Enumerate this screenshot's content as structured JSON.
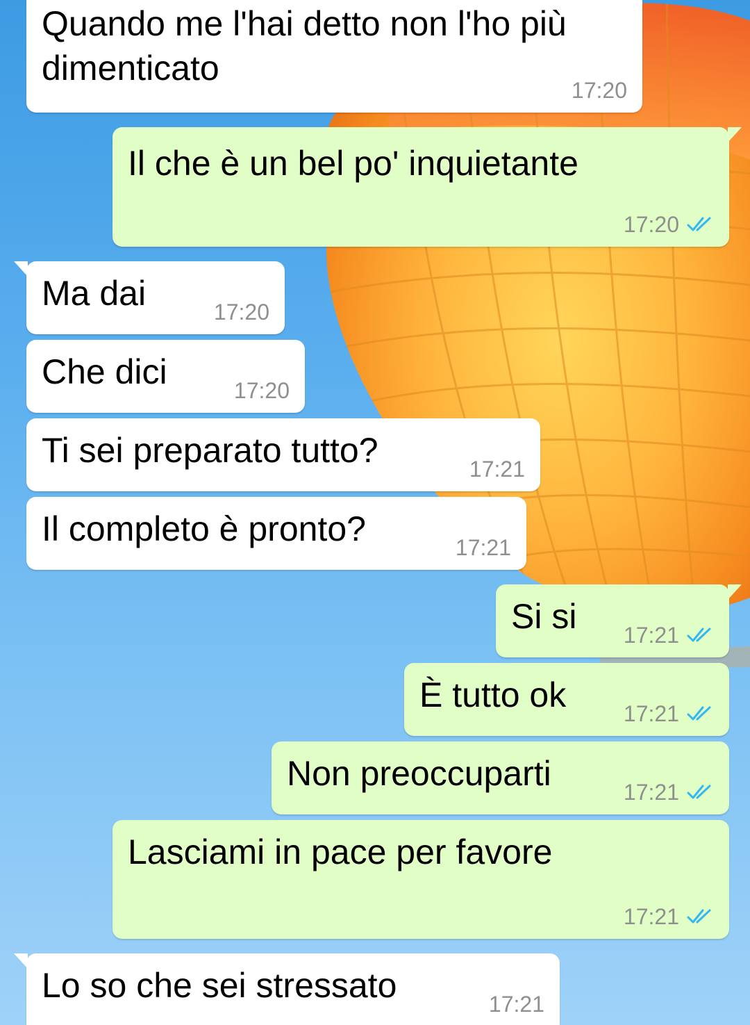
{
  "colors": {
    "incoming_bubble": "#ffffff",
    "outgoing_bubble": "#e1fec6",
    "timestamp": "#8f8f8f",
    "read_ticks": "#34b7f1",
    "wallpaper_sky": "#5aaeee",
    "wallpaper_balloon": "#f79a2a"
  },
  "wallpaper": {
    "subject": "hot-air-balloon"
  },
  "messages": [
    {
      "direction": "incoming",
      "text": "Quando me l'hai detto non l'ho più dimenticato",
      "time": "17:20"
    },
    {
      "direction": "outgoing",
      "text": "Il che è un bel po' inquietante",
      "time": "17:20",
      "status_icon": "double-check-read-icon"
    },
    {
      "direction": "incoming",
      "text": "Ma dai",
      "time": "17:20"
    },
    {
      "direction": "incoming",
      "text": "Che dici",
      "time": "17:20"
    },
    {
      "direction": "incoming",
      "text": "Ti sei preparato tutto?",
      "time": "17:21"
    },
    {
      "direction": "incoming",
      "text": "Il completo è pronto?",
      "time": "17:21"
    },
    {
      "direction": "outgoing",
      "text": "Si si",
      "time": "17:21",
      "status_icon": "double-check-read-icon"
    },
    {
      "direction": "outgoing",
      "text": "È tutto ok",
      "time": "17:21",
      "status_icon": "double-check-read-icon"
    },
    {
      "direction": "outgoing",
      "text": "Non preoccuparti",
      "time": "17:21",
      "status_icon": "double-check-read-icon"
    },
    {
      "direction": "outgoing",
      "text": "Lasciami in pace per favore",
      "time": "17:21",
      "status_icon": "double-check-read-icon"
    },
    {
      "direction": "incoming",
      "text": "Lo so che sei stressato",
      "time": "17:21"
    }
  ]
}
